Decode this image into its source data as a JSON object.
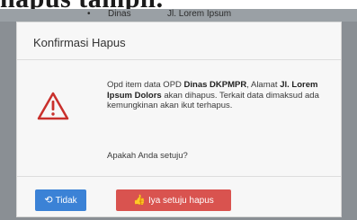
{
  "page_caption": "hapus tampil.",
  "background_row": {
    "dot": "•",
    "col1": "Dinas",
    "col2": "Jl. Lorem Ipsum"
  },
  "dialog": {
    "title": "Konfirmasi Hapus",
    "message": {
      "part1": "Opd item data OPD ",
      "opd_name": "Dinas DKPMPR",
      "part2": ", Alamat ",
      "address": "Jl. Lorem Ipsum Dolors",
      "part3": " akan dihapus. Terkait data dimaksud ada kemungkinan akan ikut terhapus."
    },
    "question": "Apakah Anda setuju?",
    "cancel_label": "Tidak",
    "confirm_label": "Iya setuju hapus",
    "icons": {
      "warning": "warning-triangle-icon",
      "cancel": "refresh-icon",
      "confirm": "thumbs-up-icon"
    },
    "colors": {
      "cancel": "#3b82d6",
      "confirm": "#d9534f",
      "warning": "#c9302c"
    }
  }
}
